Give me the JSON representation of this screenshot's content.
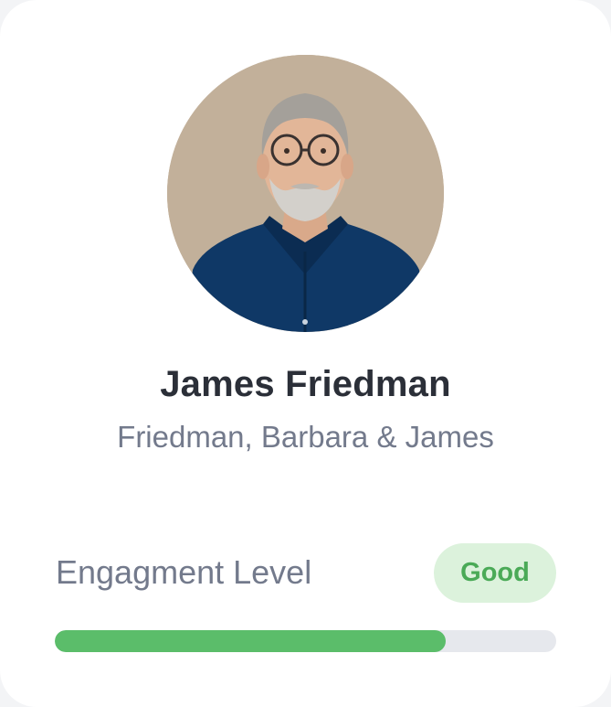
{
  "profile": {
    "name": "James Friedman",
    "household": "Friedman, Barbara & James"
  },
  "engagement": {
    "label": "Engagment Level",
    "status": "Good",
    "progress_fraction": 0.78
  },
  "colors": {
    "status_text": "#4aaa57",
    "status_bg": "#dcf2dc",
    "progress_fill": "#5bbd6a",
    "progress_track": "#e6e8ed"
  }
}
